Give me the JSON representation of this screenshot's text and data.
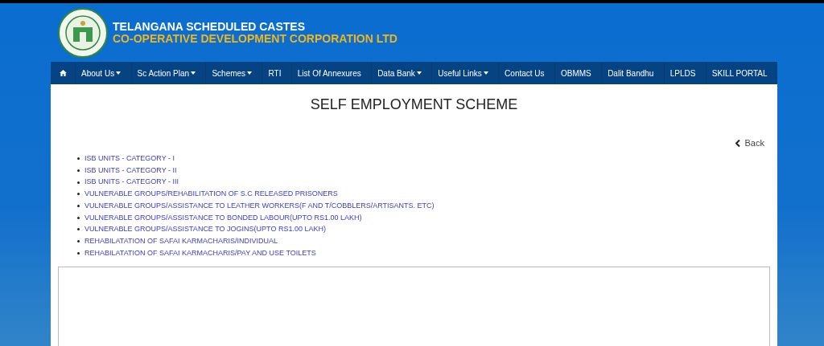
{
  "header": {
    "title_line_1": "TELANGANA SCHEDULED CASTES",
    "title_line_2": "CO-OPERATIVE DEVELOPMENT CORPORATION LTD"
  },
  "nav": [
    {
      "label": "About Us",
      "dropdown": true
    },
    {
      "label": "Sc Action Plan",
      "dropdown": true
    },
    {
      "label": "Schemes",
      "dropdown": true
    },
    {
      "label": "RTI",
      "dropdown": false
    },
    {
      "label": "List Of Annexures",
      "dropdown": false
    },
    {
      "label": "Data Bank",
      "dropdown": true
    },
    {
      "label": "Useful Links",
      "dropdown": true
    },
    {
      "label": "Contact Us",
      "dropdown": false
    },
    {
      "label": "OBMMS",
      "dropdown": false
    },
    {
      "label": "Dalit Bandhu",
      "dropdown": false
    },
    {
      "label": "LPLDS",
      "dropdown": false
    },
    {
      "label": "SKILL PORTAL",
      "dropdown": false
    }
  ],
  "page_title": "SELF EMPLOYMENT SCHEME",
  "back_link": "Back",
  "links": [
    "ISB UNITS - CATEGORY - I",
    "ISB UNITS - CATEGORY - II",
    "ISB UNITS - CATEGORY - III",
    "VULNERABLE GROUPS/REHABILITATION OF S.C RELEASED PRISONERS",
    "VULNERABLE GROUPS/ASSISTANCE TO LEATHER WORKERS(F AND T/COBBLERS/ARTISANTS. ETC)",
    "VULNERABLE GROUPS/ASSISTANCE TO BONDED LABOUR(UPTO RS1.00 LAKH)",
    "VULNERABLE GROUPS/ASSISTANCE TO JOGINS(UPTO RS1.00 LAKH)",
    "REHABILATATION OF SAFAI KARMACHARIS/INDIVIDUAL",
    "REHABILATATION OF SAFAI KARMACHARIS/PAY AND USE TOILETS"
  ]
}
